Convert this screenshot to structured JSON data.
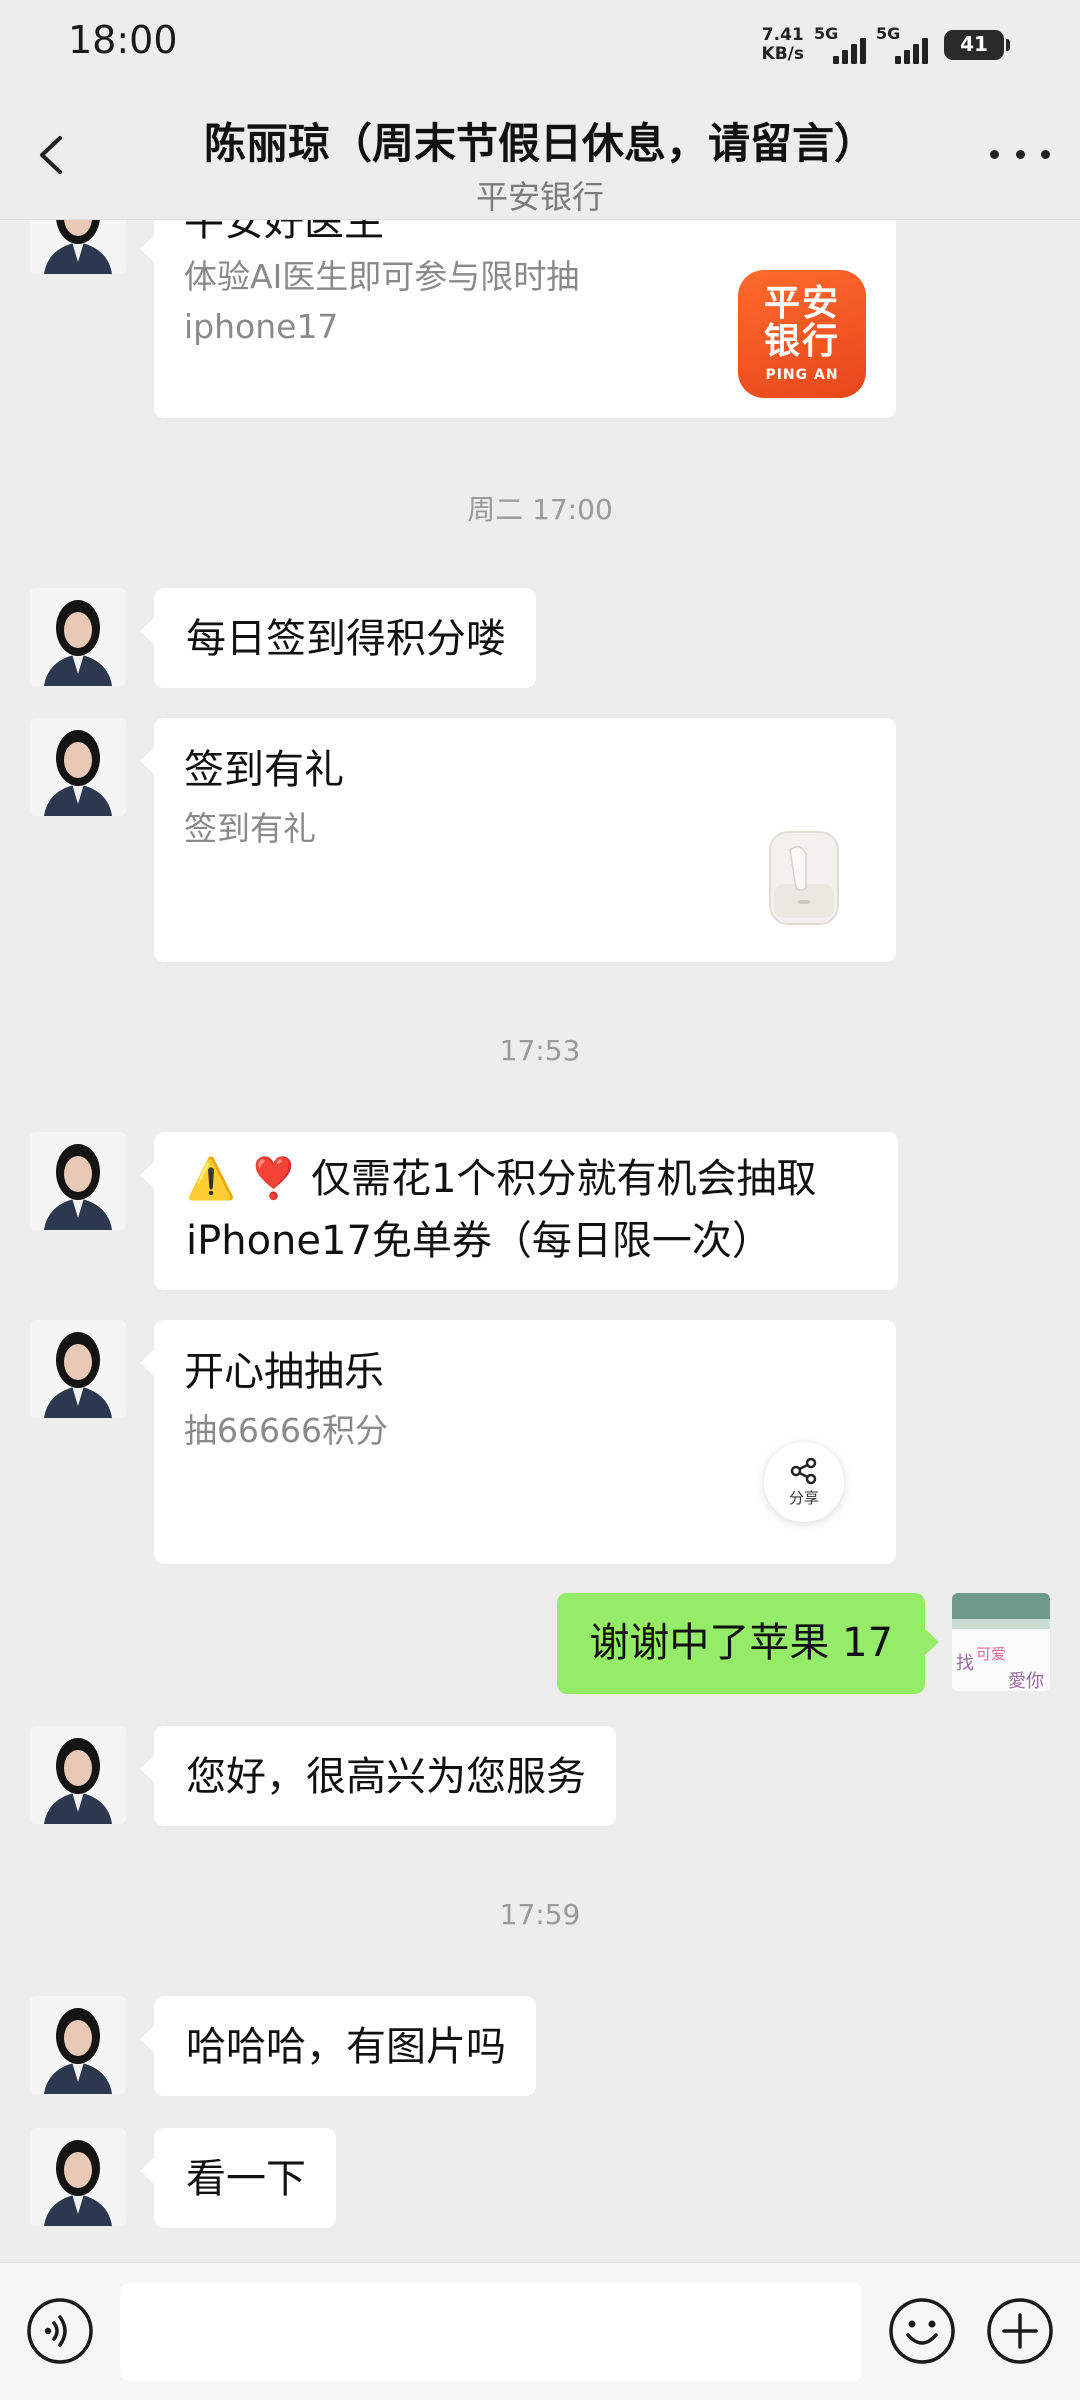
{
  "status_bar": {
    "time": "18:00",
    "net_speed_value": "7.41",
    "net_speed_unit": "KB/s",
    "signal_1": "5G",
    "signal_2": "5G",
    "battery": "41"
  },
  "header": {
    "title": "陈丽琼（周末节假日休息，请留言）",
    "subtitle": "平安银行"
  },
  "messages": {
    "card_doctor": {
      "title": "平安好医生",
      "desc_line1": "体验AI医生即可参与限时抽",
      "desc_line2": "iphone17",
      "logo_text": "平安银行",
      "logo_sub": "PING AN"
    },
    "time_1": "周二 17:00",
    "msg_checkin": "每日签到得积分喽",
    "card_checkin": {
      "title": "签到有礼",
      "desc": "签到有礼"
    },
    "time_2": "17:53",
    "msg_lottery_line1": "⚠️ ❣️ 仅需花1个积分就有机会抽取",
    "msg_lottery_line2": "iPhone17免单券（每日限一次）",
    "card_lottery": {
      "title": "开心抽抽乐",
      "desc": "抽66666积分",
      "share_label": "分享"
    },
    "sent_msg": "谢谢中了苹果 17",
    "my_avatar_text_1": "找",
    "my_avatar_text_2": "可爱",
    "my_avatar_text_3": "愛你",
    "msg_greeting": "您好，很高兴为您服务",
    "time_3": "17:59",
    "msg_picture": "哈哈哈，有图片吗",
    "msg_look": "看一下"
  },
  "colors": {
    "background": "#ededed",
    "sent_bubble": "#95ec69",
    "received_bubble": "#ffffff",
    "pingan_orange": "#f05a24"
  }
}
